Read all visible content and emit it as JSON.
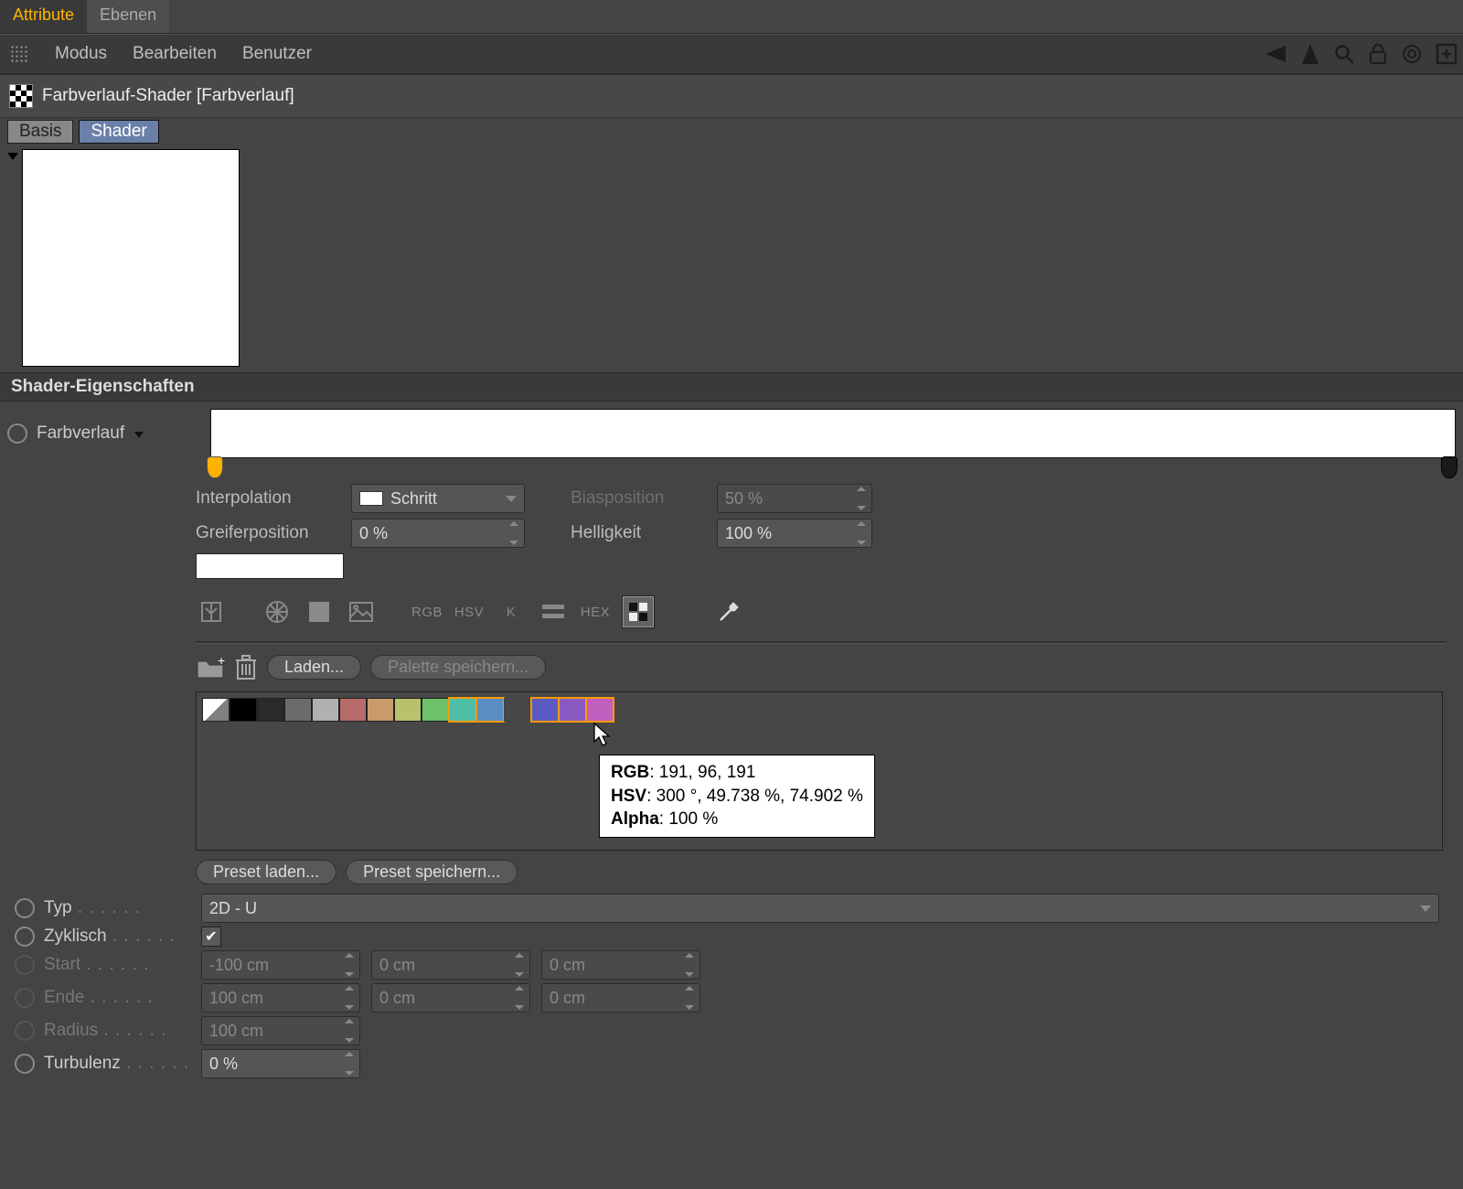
{
  "tabs": {
    "attribute": "Attribute",
    "layers": "Ebenen"
  },
  "menus": {
    "mode": "Modus",
    "edit": "Bearbeiten",
    "user": "Benutzer"
  },
  "title": "Farbverlauf-Shader [Farbverlauf]",
  "subtabs": {
    "basis": "Basis",
    "shader": "Shader"
  },
  "section_header": "Shader-Eigenschaften",
  "gradient_label": "Farbverlauf",
  "props": {
    "interpolation_label": "Interpolation",
    "interpolation_value": "Schritt",
    "knot_label": "Greiferposition",
    "knot_value": "0 %",
    "bias_label": "Biasposition",
    "bias_value": "50 %",
    "brightness_label": "Helligkeit",
    "brightness_value": "100 %"
  },
  "mode_icons": {
    "rgb": "RGB",
    "hsv": "HSV",
    "k": "K",
    "hex": "HEX"
  },
  "palette_buttons": {
    "load": "Laden...",
    "save": "Palette speichern..."
  },
  "swatches": [
    "flag",
    "#000000",
    "#2a2a2a",
    "#6b6b6b",
    "#b0b0b0",
    "#b86b6b",
    "#c89b6b",
    "#b7c26b",
    "#6fc26b",
    "#4fbfa8",
    "#5a8ec2",
    "empty",
    "#5a5ac2",
    "#8a5ac2",
    "#bf60bf"
  ],
  "swatch_selected": [
    9,
    10,
    12,
    13,
    14
  ],
  "tooltip": {
    "rgb_label": "RGB",
    "rgb_value": ": 191, 96, 191",
    "hsv_label": "HSV",
    "hsv_value": ": 300 °, 49.738 %, 74.902 %",
    "alpha_label": "Alpha",
    "alpha_value": ": 100 %"
  },
  "preset_buttons": {
    "load": "Preset laden...",
    "save": "Preset speichern..."
  },
  "params": {
    "type_label": "Typ",
    "type_value": "2D - U",
    "cyclic_label": "Zyklisch",
    "cyclic_checked": true,
    "start_label": "Start",
    "start_values": [
      "-100 cm",
      "0 cm",
      "0 cm"
    ],
    "end_label": "Ende",
    "end_values": [
      "100 cm",
      "0 cm",
      "0 cm"
    ],
    "radius_label": "Radius",
    "radius_value": "100 cm",
    "turb_label": "Turbulenz",
    "turb_value": "0 %"
  }
}
